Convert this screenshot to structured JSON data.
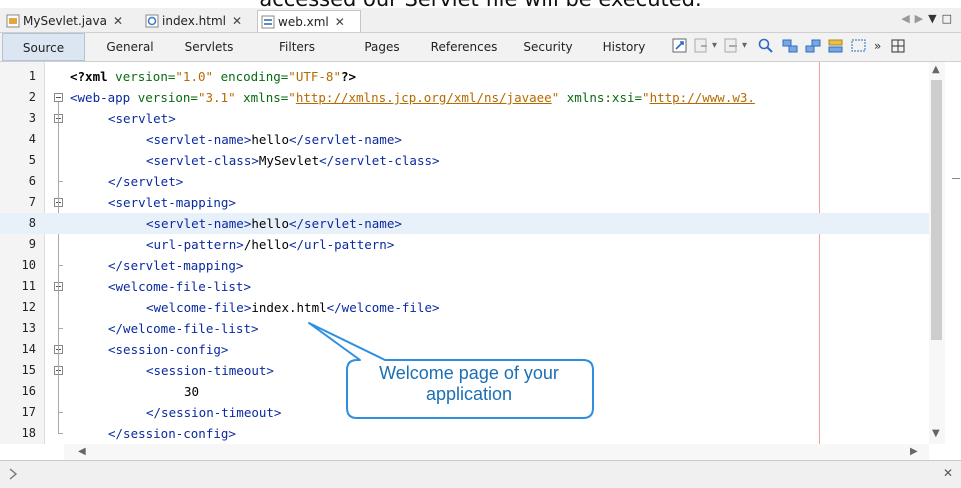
{
  "caption": "accessed our Servlet file will be executed.",
  "tabs": [
    {
      "label": "MySevlet.java",
      "icon": "java-file-icon",
      "active": false
    },
    {
      "label": "index.html",
      "icon": "html-file-icon",
      "active": false
    },
    {
      "label": "web.xml",
      "icon": "xml-file-icon",
      "active": true
    }
  ],
  "views": [
    "Source",
    "General",
    "Servlets",
    "Filters",
    "Pages",
    "References",
    "Security",
    "History"
  ],
  "active_view": "Source",
  "toolbar_icons": [
    "last-edit-icon",
    "back-icon",
    "forward-icon",
    "find-selection-icon",
    "find-previous-icon",
    "find-next-icon",
    "toggle-highlight-icon",
    "toggle-rect-selection-icon",
    "more-icon",
    "grid-icon"
  ],
  "code_lines": [
    {
      "n": "1",
      "text": "<?xml version=\"1.0\" encoding=\"UTF-8\"?>"
    },
    {
      "n": "2",
      "text": "<web-app version=\"3.1\" xmlns=\"http://xmlns.jcp.org/xml/ns/javaee\" xmlns:xsi=\"http://www.w3."
    },
    {
      "n": "3",
      "text": "<servlet>"
    },
    {
      "n": "4",
      "text": "<servlet-name>hello</servlet-name>"
    },
    {
      "n": "5",
      "text": "<servlet-class>MySevlet</servlet-class>"
    },
    {
      "n": "6",
      "text": "</servlet>"
    },
    {
      "n": "7",
      "text": "<servlet-mapping>"
    },
    {
      "n": "8",
      "text": "<servlet-name>hello</servlet-name>"
    },
    {
      "n": "9",
      "text": "<url-pattern>/hello</url-pattern>"
    },
    {
      "n": "10",
      "text": "</servlet-mapping>"
    },
    {
      "n": "11",
      "text": "<welcome-file-list>"
    },
    {
      "n": "12",
      "text": "<welcome-file>index.html</welcome-file>"
    },
    {
      "n": "13",
      "text": "</welcome-file-list>"
    },
    {
      "n": "14",
      "text": "<session-config>"
    },
    {
      "n": "15",
      "text": "<session-timeout>"
    },
    {
      "n": "16",
      "text": "30"
    },
    {
      "n": "17",
      "text": "</session-timeout>"
    },
    {
      "n": "18",
      "text": "</session-config>"
    }
  ],
  "highlighted_line": "8",
  "callout": {
    "line1": "Welcome page of your",
    "line2": "application"
  },
  "colors": {
    "tag": "#0a2aa0",
    "attr": "#086b10",
    "value": "#b56a00",
    "accent": "#1a6fb5"
  }
}
